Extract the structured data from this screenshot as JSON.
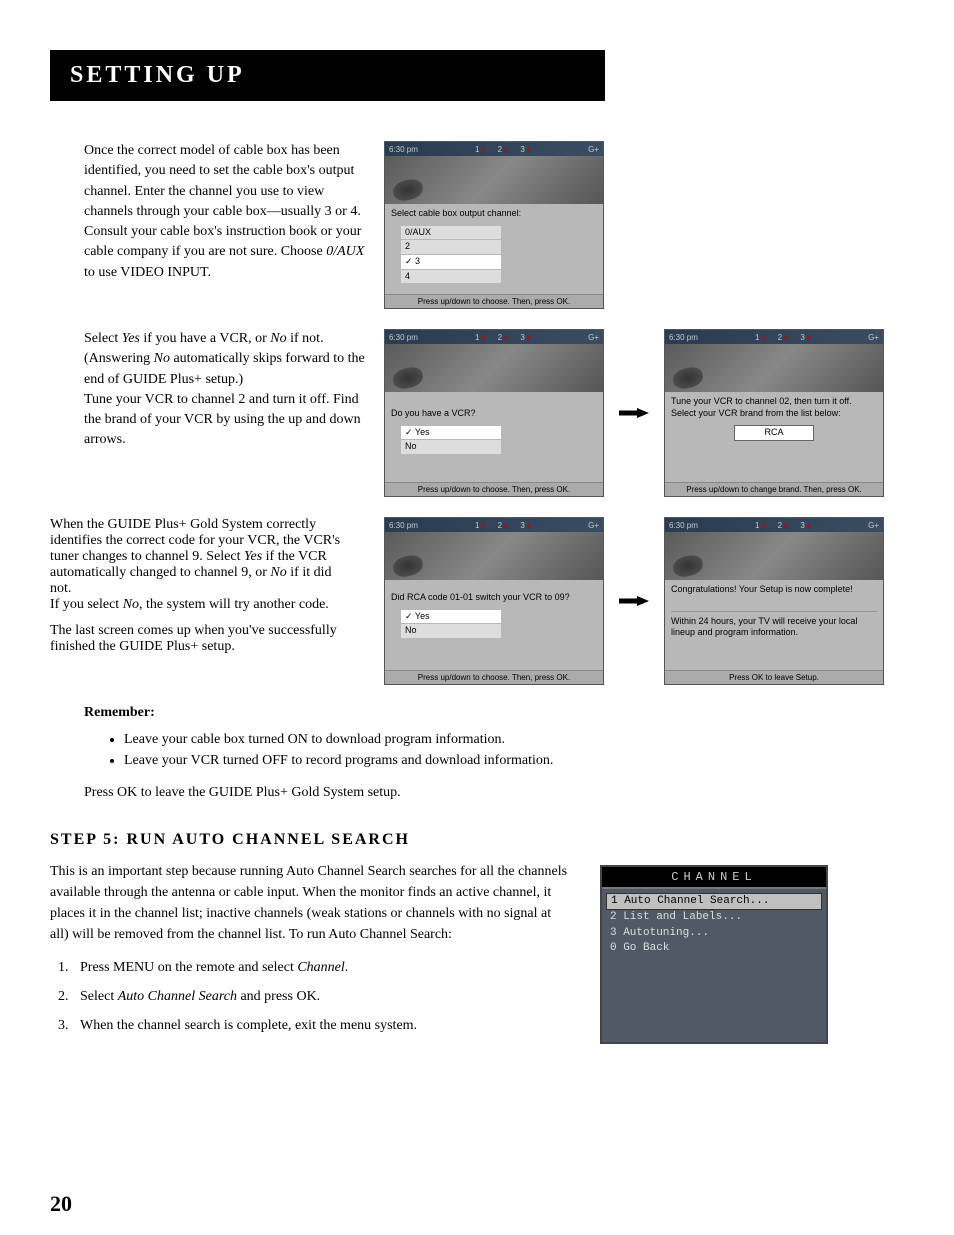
{
  "header": {
    "title": "Setting Up"
  },
  "section1": {
    "paragraph": "Once the correct model of cable box has been identified, you need to set the cable box's output channel. Enter the channel you use to view channels through your cable box—usually 3 or 4. Consult your cable box's instruction book or your cable company if you are not sure. Choose ",
    "aux": "0/AUX",
    "aux_after": " to use VIDEO INPUT."
  },
  "screen_common": {
    "time": "6:30 pm",
    "tabs": [
      "1",
      "2",
      "3"
    ],
    "brand": "G+"
  },
  "screen1": {
    "prompt": "Select cable box output channel:",
    "options": [
      "0/AUX",
      "2",
      "3",
      "4"
    ],
    "selected_index": 2,
    "footer": "Press up/down to choose. Then, press OK."
  },
  "section2": {
    "p1a": "Select ",
    "yes": "Yes",
    "p1b": " if you have a VCR, or ",
    "no": "No",
    "p1c": " if not. (Answering ",
    "p1d": " automatically skips forward to the end of  GUIDE Plus+ setup.)",
    "p2": "Tune your VCR to channel 2 and turn it off. Find the brand of your VCR by using the up and down arrows."
  },
  "screen2a": {
    "prompt": "Do you have a VCR?",
    "options": [
      "Yes",
      "No"
    ],
    "selected_index": 0,
    "footer": "Press up/down to choose. Then, press OK."
  },
  "screen2b": {
    "prompt": "Tune your VCR to channel 02, then turn it off. Select your VCR brand from the list below:",
    "brand": "RCA",
    "footer": "Press up/down to change brand. Then, press OK."
  },
  "section3": {
    "p1": "When the GUIDE Plus+ Gold System correctly identifies the correct code for your VCR, the VCR's tuner changes to channel 9. Select ",
    "yes": "Yes",
    "p1b": " if the VCR automatically changed to channel 9, or ",
    "no": "No",
    "p1c": " if it did not.",
    "p2a": "If you select ",
    "p2b": ", the system will try another code.",
    "p3": "The last screen comes up when you've successfully finished the GUIDE Plus+ setup."
  },
  "screen3a": {
    "prompt": "Did RCA code 01-01 switch your VCR to 09?",
    "options": [
      "Yes",
      "No"
    ],
    "selected_index": 0,
    "footer": "Press up/down to choose. Then, press OK."
  },
  "screen3b": {
    "line1": "Congratulations!  Your Setup is now complete!",
    "line2": "Within 24 hours, your TV will receive your local lineup and program information.",
    "footer": "Press OK to leave Setup."
  },
  "remember": {
    "label": "Remember:",
    "items": [
      "Leave your cable box turned ON to download program information.",
      "Leave your VCR turned OFF to record programs and download information."
    ],
    "press_ok": "Press OK to leave the GUIDE Plus+ Gold System setup."
  },
  "step5": {
    "heading": "Step 5: Run Auto Channel Search",
    "paragraph": "This is an important step because running Auto Channel Search searches for all the channels available through the antenna or cable input. When the monitor finds an active channel, it places it in the channel list; inactive channels (weak stations or channels with no signal at all) will be removed from the channel list. To run Auto Channel Search:",
    "steps": [
      {
        "pre": "Press MENU on the remote and select ",
        "i": "Channel",
        "post": "."
      },
      {
        "pre": "Select ",
        "i": "Auto Channel Search",
        "post": " and press OK."
      },
      {
        "pre": "When the channel search is complete, exit the menu system.",
        "i": "",
        "post": ""
      }
    ]
  },
  "channel_menu": {
    "header": "CHANNEL",
    "items": [
      "1 Auto Channel Search...",
      "2 List and Labels...",
      "3 Autotuning...",
      "0 Go Back"
    ],
    "active_index": 0
  },
  "page_number": "20"
}
